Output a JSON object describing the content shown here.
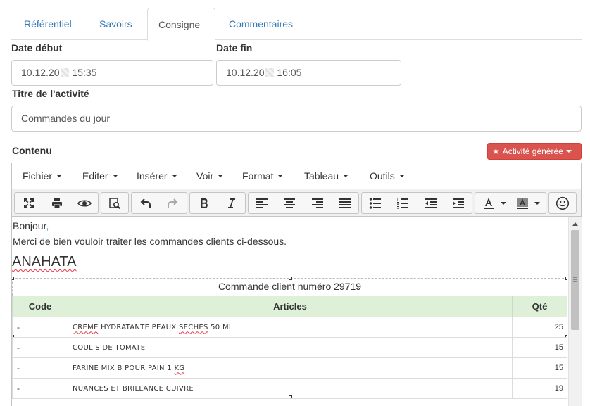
{
  "tabs": [
    {
      "label": "Référentiel",
      "active": false
    },
    {
      "label": "Savoirs",
      "active": false
    },
    {
      "label": "Consigne",
      "active": true
    },
    {
      "label": "Commentaires",
      "active": false
    }
  ],
  "form": {
    "date_debut_label": "Date début",
    "date_debut_prefix": "10.12.20",
    "date_debut_suffix": " 15:35",
    "date_fin_label": "Date fin",
    "date_fin_prefix": "10.12.20",
    "date_fin_suffix": " 16:05",
    "titre_label": "Titre de l'activité",
    "titre_value": "Commandes du jour",
    "contenu_label": "Contenu"
  },
  "generate_button": {
    "label": "Activité générée",
    "icon": "star-icon",
    "color": "#d9534f"
  },
  "editor": {
    "menus": [
      "Fichier",
      "Editer",
      "Insérer",
      "Voir",
      "Format",
      "Tableau",
      "Outils"
    ],
    "toolbar": [
      "fullscreen-icon",
      "print-icon",
      "preview-icon",
      "find-replace-icon",
      "undo-icon",
      "redo-icon",
      "bold-icon",
      "italic-icon",
      "align-left-icon",
      "align-center-icon",
      "align-right-icon",
      "align-justify-icon",
      "bullet-list-icon",
      "numbered-list-icon",
      "outdent-icon",
      "indent-icon",
      "text-color-icon",
      "background-color-icon",
      "emoticon-icon"
    ],
    "content": {
      "greeting": "Bonjour",
      "greeting_punct": ",",
      "intro": "Merci de bien vouloir traiter les commandes clients ci-dessous.",
      "heading": "ANAHATA",
      "caption": "Commande client numéro 29719",
      "table": {
        "headers": [
          "Code",
          "Articles",
          "Qté"
        ],
        "header_color": "#dff0d8",
        "rows": [
          {
            "code": "-",
            "article": "CREME HYDRATANTE PEAUX SECHES 50 ML",
            "qty": "25"
          },
          {
            "code": "-",
            "article": "COULIS DE TOMATE",
            "qty": "15"
          },
          {
            "code": "-",
            "article": "FARINE MIX B POUR PAIN 1 KG",
            "qty": "15"
          },
          {
            "code": "-",
            "article": "NUANCES ET BRILLANCE CUIVRE",
            "qty": "19"
          }
        ]
      }
    }
  }
}
